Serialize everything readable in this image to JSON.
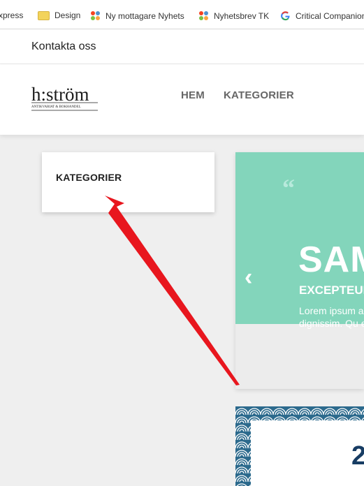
{
  "bookmarks": [
    "xpress",
    "Design",
    "Ny mottagare Nyhets",
    "Nyhetsbrev TK",
    "Critical Companion"
  ],
  "topbar": {
    "contact": "Kontakta oss"
  },
  "header": {
    "nav": [
      "HEM",
      "KATEGORIER"
    ],
    "logo_text": "h:ström",
    "logo_sub": "ANTIKVARIAT & BOKHANDEL"
  },
  "sidebar": {
    "title": "KATEGORIER"
  },
  "slider": {
    "title": "SAM",
    "subtitle": "EXCEPTEUR",
    "text": "Lorem ipsum adipiscing elit dignissim. Qu egestas sem e"
  },
  "promo": {
    "number": "2"
  },
  "colors": {
    "accent": "#83d5bb",
    "arrow": "#e8161e",
    "pattern": "#2c6a8d"
  }
}
